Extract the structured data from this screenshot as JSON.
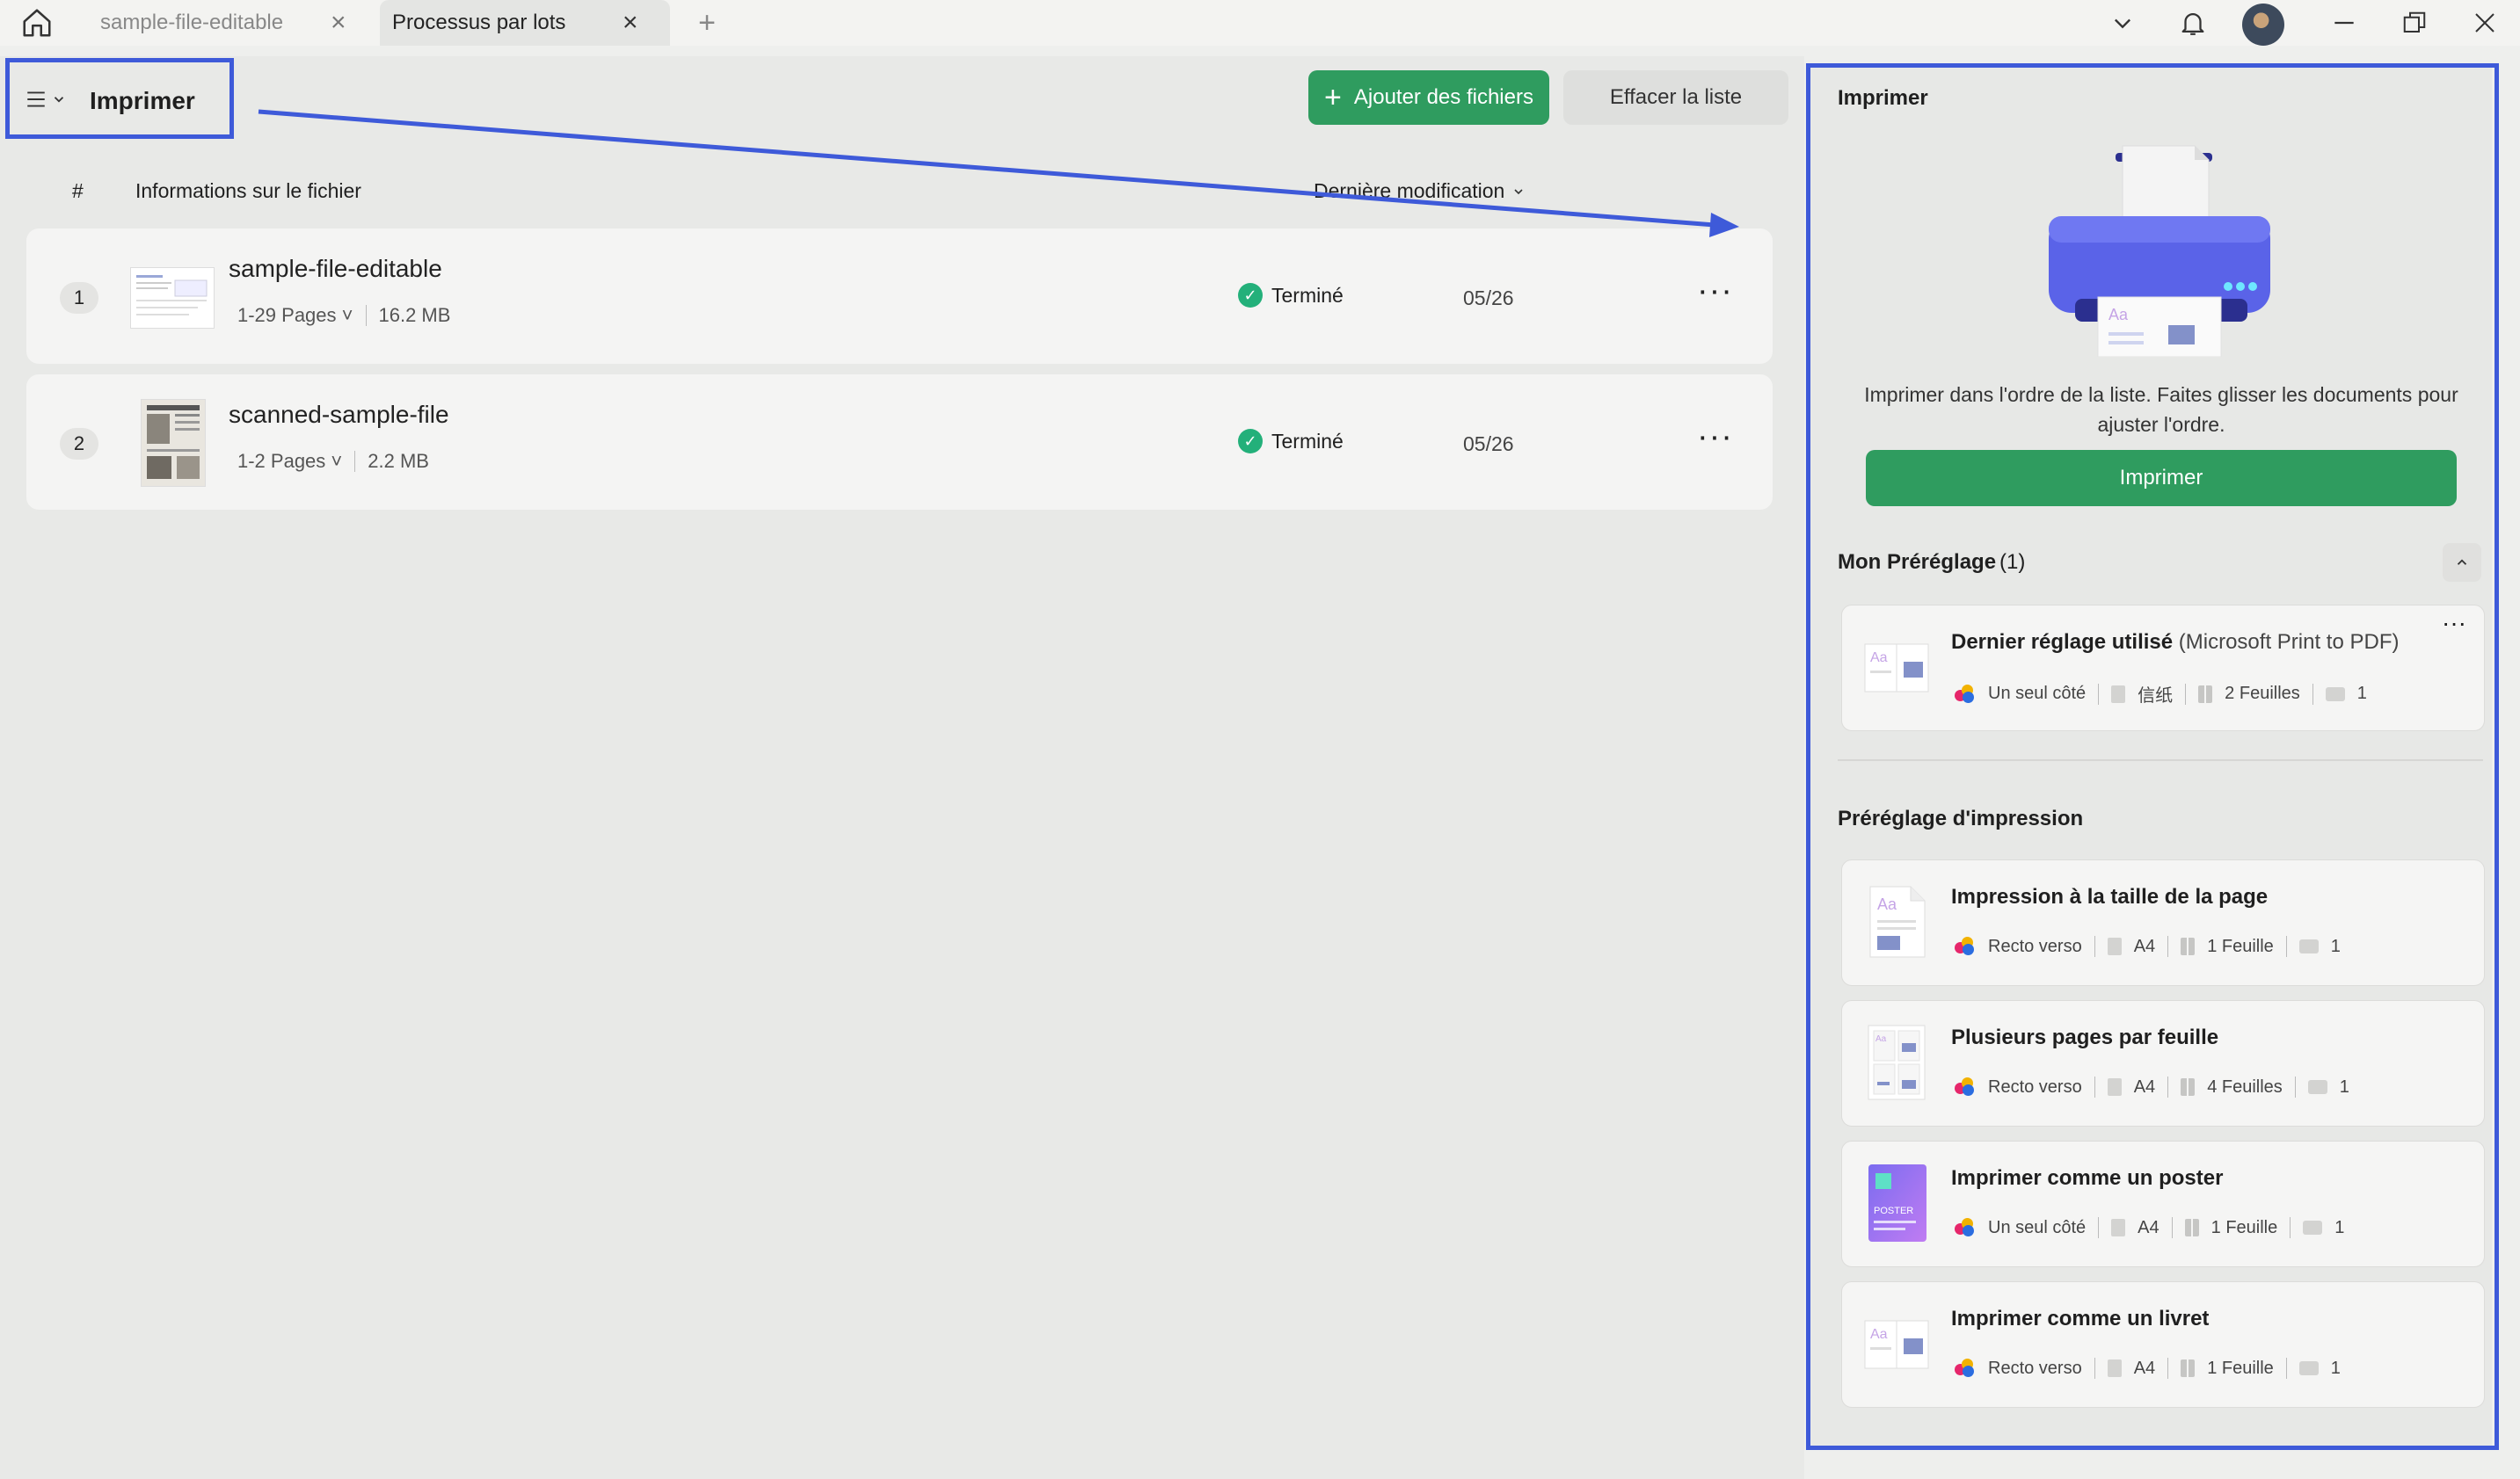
{
  "titlebar": {
    "tabs": [
      {
        "label": "sample-file-editable",
        "active": false
      },
      {
        "label": "Processus par lots",
        "active": true
      }
    ],
    "icons": [
      "home-icon",
      "close-icon",
      "plus-icon",
      "chevron-down-icon",
      "bell-icon",
      "avatar",
      "minimize-icon",
      "restore-icon",
      "close-window-icon"
    ]
  },
  "toolbar": {
    "menu_label": "Imprimer",
    "add_files_label": "Ajouter des fichiers",
    "clear_list_label": "Effacer la liste"
  },
  "table": {
    "col_number": "#",
    "col_info": "Informations sur le fichier",
    "col_modified": "Dernière modification",
    "rows": [
      {
        "index": "1",
        "name": "sample-file-editable",
        "pages": "1-29 Pages",
        "size": "16.2 MB",
        "status": "Terminé",
        "date": "05/26"
      },
      {
        "index": "2",
        "name": "scanned-sample-file",
        "pages": "1-2 Pages",
        "size": "2.2 MB",
        "status": "Terminé",
        "date": "05/26"
      }
    ]
  },
  "panel": {
    "title": "Imprimer",
    "description": "Imprimer dans l'ordre de la liste. Faites glisser les documents pour ajuster l'ordre.",
    "print_button": "Imprimer",
    "my_preset_title": "Mon Préréglage",
    "my_preset_count": "(1)",
    "my_preset": {
      "title": "Dernier réglage utilisé",
      "extra": "(Microsoft Print to PDF)",
      "sides": "Un seul côté",
      "paper": "信纸",
      "sheets": "2 Feuilles",
      "copies": "1"
    },
    "print_presets_title": "Préréglage d'impression",
    "presets": [
      {
        "title": "Impression à la taille de la page",
        "sides": "Recto verso",
        "paper": "A4",
        "sheets": "1 Feuille",
        "copies": "1"
      },
      {
        "title": "Plusieurs pages par feuille",
        "sides": "Recto verso",
        "paper": "A4",
        "sheets": "4 Feuilles",
        "copies": "1"
      },
      {
        "title": "Imprimer comme un poster",
        "sides": "Un seul côté",
        "paper": "A4",
        "sheets": "1 Feuille",
        "copies": "1"
      },
      {
        "title": "Imprimer comme un livret",
        "sides": "Recto verso",
        "paper": "A4",
        "sheets": "1 Feuille",
        "copies": "1"
      }
    ],
    "poster_icon_text": "POSTER",
    "thumb_text": "Aa"
  },
  "colors": {
    "accent_green": "#2f9c5f",
    "highlight_blue": "#3e5ad9",
    "printer_blue": "#5a63e8",
    "status_green": "#23b07a"
  }
}
